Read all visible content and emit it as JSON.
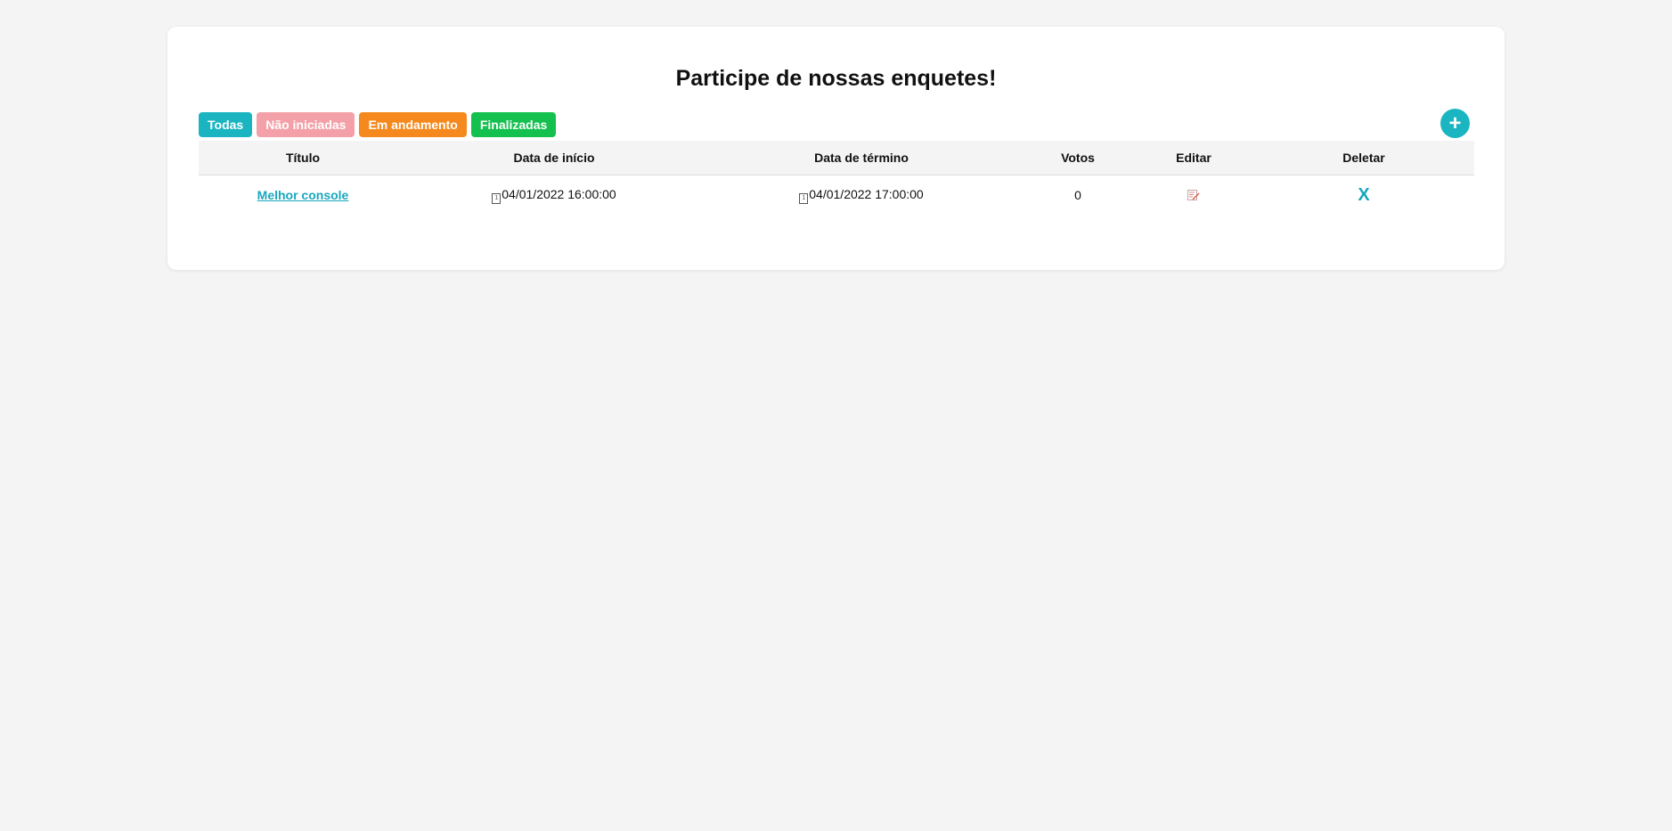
{
  "colors": {
    "teal": "#1bb5c1",
    "pink": "#f4a0a8",
    "orange": "#f5891e",
    "green": "#14c04e",
    "link": "#1aa7bd"
  },
  "header": {
    "title": "Participe de nossas enquetes!"
  },
  "filters": [
    {
      "label": "Todas",
      "color": "#1bb5c1"
    },
    {
      "label": "Não iniciadas",
      "color": "#f4a0a8"
    },
    {
      "label": "Em andamento",
      "color": "#f5891e"
    },
    {
      "label": "Finalizadas",
      "color": "#14c04e"
    }
  ],
  "add_button": {
    "label": "+",
    "icon": "plus-icon",
    "color": "#1bb5c1"
  },
  "table": {
    "columns": [
      "Título",
      "Data de início",
      "Data de término",
      "Votos",
      "Editar",
      "Deletar"
    ],
    "rows": [
      {
        "title": "Melhor console",
        "start": "04/01/2022 16:00:00",
        "end": "04/01/2022 17:00:00",
        "votes": "0",
        "edit_icon": "edit-icon",
        "delete_label": "X"
      }
    ]
  },
  "icons": {
    "calendar_glyph": "1"
  }
}
